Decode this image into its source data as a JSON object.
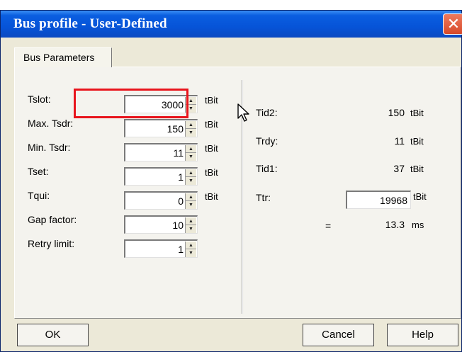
{
  "window": {
    "title": "Bus profile - User-Defined",
    "close_glyph": "✕"
  },
  "tab": {
    "label": "Bus Parameters"
  },
  "left_params": [
    {
      "label": "Tslot:",
      "value": "3000",
      "unit": "tBit"
    },
    {
      "label": "Max. Tsdr:",
      "value": "150",
      "unit": "tBit"
    },
    {
      "label": "Min. Tsdr:",
      "value": "11",
      "unit": "tBit"
    },
    {
      "label": "Tset:",
      "value": "1",
      "unit": "tBit"
    },
    {
      "label": "Tqui:",
      "value": "0",
      "unit": "tBit"
    },
    {
      "label": "Gap factor:",
      "value": "10",
      "unit": ""
    },
    {
      "label": "Retry limit:",
      "value": "1",
      "unit": ""
    }
  ],
  "right_params": {
    "tid2": {
      "label": "Tid2:",
      "value": "150",
      "unit": "tBit"
    },
    "trdy": {
      "label": "Trdy:",
      "value": "11",
      "unit": "tBit"
    },
    "tid1": {
      "label": "Tid1:",
      "value": "37",
      "unit": "tBit"
    },
    "ttr": {
      "label": "Ttr:",
      "value": "19968",
      "unit": "tBit"
    },
    "ttr_ms": {
      "eq": "=",
      "value": "13.3",
      "unit": "ms"
    }
  },
  "buttons": {
    "ok": "OK",
    "cancel": "Cancel",
    "help": "Help"
  },
  "colors": {
    "title_bar": "#0654d8",
    "highlight": "#e8141c",
    "dialog_bg": "#ece9d8"
  },
  "icons": {
    "spinner_up": "▲",
    "spinner_down": "▼"
  }
}
